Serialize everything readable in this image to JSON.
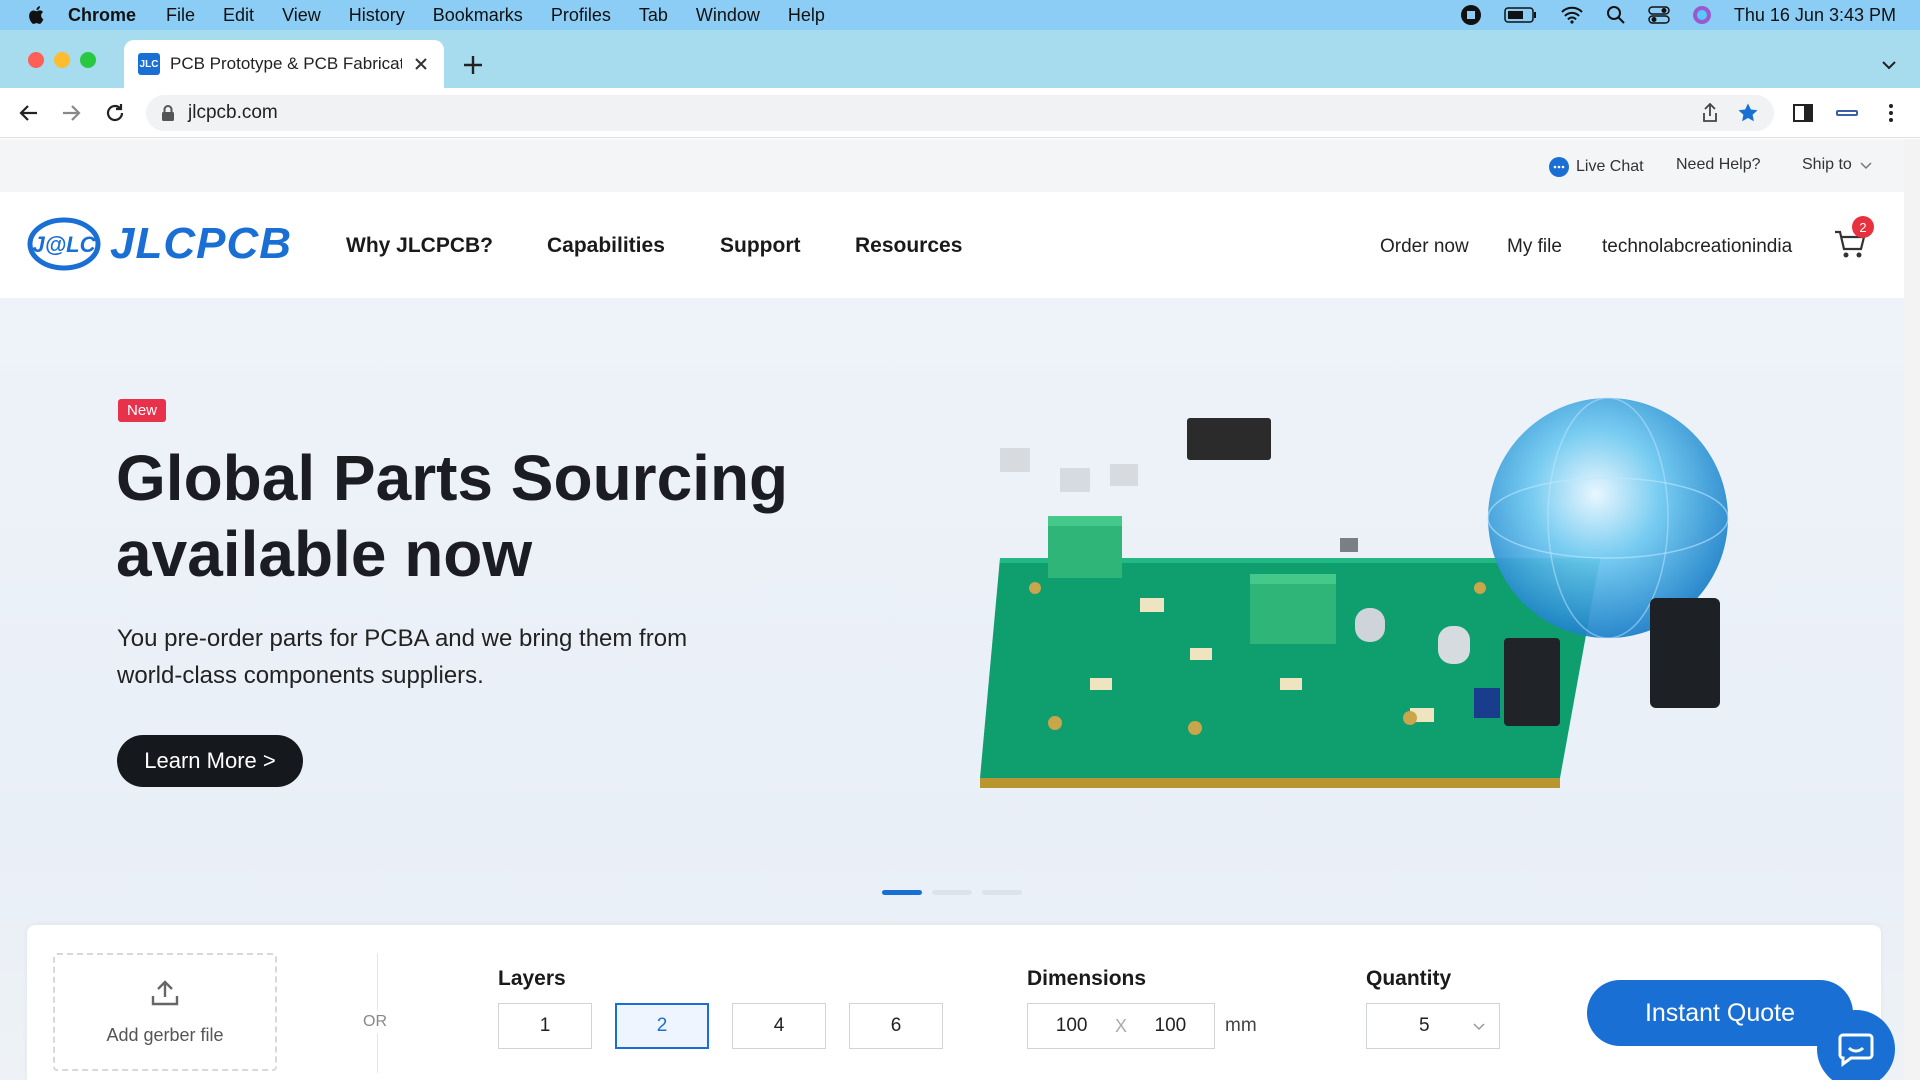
{
  "menubar": {
    "app": "Chrome",
    "items": [
      "File",
      "Edit",
      "View",
      "History",
      "Bookmarks",
      "Profiles",
      "Tab",
      "Window",
      "Help"
    ],
    "clock": "Thu 16 Jun  3:43 PM"
  },
  "browser": {
    "tab_title": "PCB Prototype & PCB Fabricati",
    "favicon_text": "JLC",
    "url": "jlcpcb.com"
  },
  "utility": {
    "live_chat": "Live Chat",
    "need_help": "Need Help?",
    "ship_to": "Ship to"
  },
  "header": {
    "logo_text": "JLCPCB",
    "logo_mark": "J@LC",
    "nav": [
      "Why JLCPCB?",
      "Capabilities",
      "Support",
      "Resources"
    ],
    "order_now": "Order now",
    "my_file": "My file",
    "username": "technolabcreationindia",
    "cart_count": "2"
  },
  "hero": {
    "badge": "New",
    "headline": "Global Parts Sourcing available now",
    "subtext": "You pre-order parts for PCBA and we bring them from world-class components suppliers.",
    "cta": "Learn More >",
    "slides": 3,
    "active_slide": 1
  },
  "quote": {
    "upload_label": "Add gerber file",
    "or_text": "OR",
    "layers_label": "Layers",
    "layers": [
      "1",
      "2",
      "4",
      "6"
    ],
    "layers_selected": "2",
    "dimensions_label": "Dimensions",
    "dim_w": "100",
    "dim_x": "X",
    "dim_h": "100",
    "dim_unit": "mm",
    "quantity_label": "Quantity",
    "quantity": "5",
    "cta": "Instant Quote"
  },
  "colors": {
    "brand_blue": "#1a6fd4",
    "badge_red": "#e8314b",
    "dark": "#15181d"
  }
}
